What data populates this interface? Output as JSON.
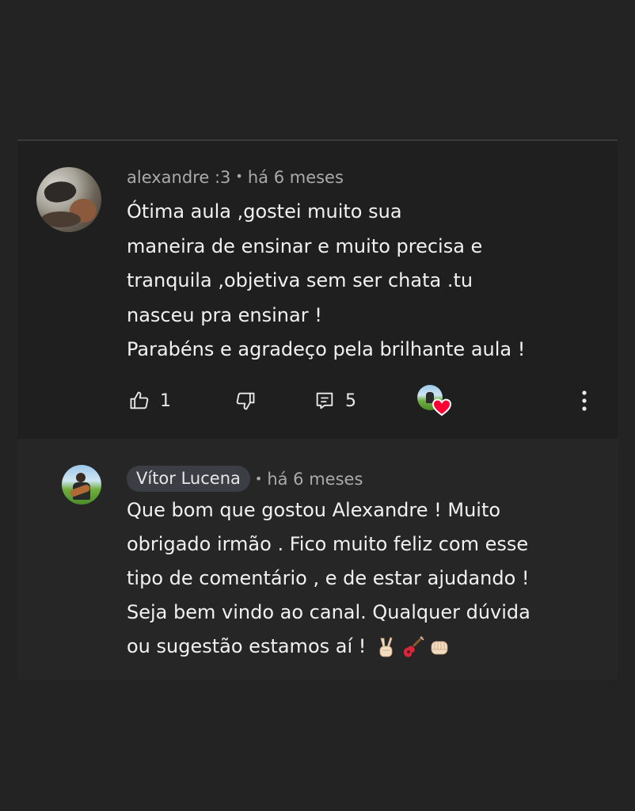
{
  "comment": {
    "author": "alexandre :3",
    "separator": "•",
    "time": "há 6 meses",
    "lines": [
      "Ótima aula ,gostei muito sua",
      "maneira de ensinar e muito precisa e",
      "tranquila ,objetiva sem ser chata .tu",
      "nasceu pra ensinar !",
      "Parabéns e agradeço pela brilhante aula !"
    ],
    "likes": "1",
    "replies": "5",
    "icons": {
      "like": "thumbs-up-icon",
      "dislike": "thumbs-down-icon",
      "reply": "comment-icon",
      "heart": "creator-heart-icon",
      "more": "more-vertical-icon"
    }
  },
  "reply": {
    "author": "Vítor Lucena",
    "separator": "•",
    "time": "há 6 meses",
    "lines": [
      "Que bom que gostou Alexandre ! Muito",
      "obrigado irmão . Fico muito feliz com esse",
      "tipo de comentário , e de estar ajudando !",
      "Seja bem vindo ao canal. Qualquer dúvida",
      "ou sugestão estamos aí !"
    ],
    "emojis": [
      "victory-hand-emoji",
      "guitar-emoji",
      "fist-bump-emoji"
    ]
  },
  "colors": {
    "background": "#232323",
    "card": "#1f1f1f",
    "reply_card": "#262626",
    "text": "#f1f1f1",
    "meta": "#aaaaaa",
    "author_chip": "#3b3f45",
    "heart": "#ff0033"
  }
}
